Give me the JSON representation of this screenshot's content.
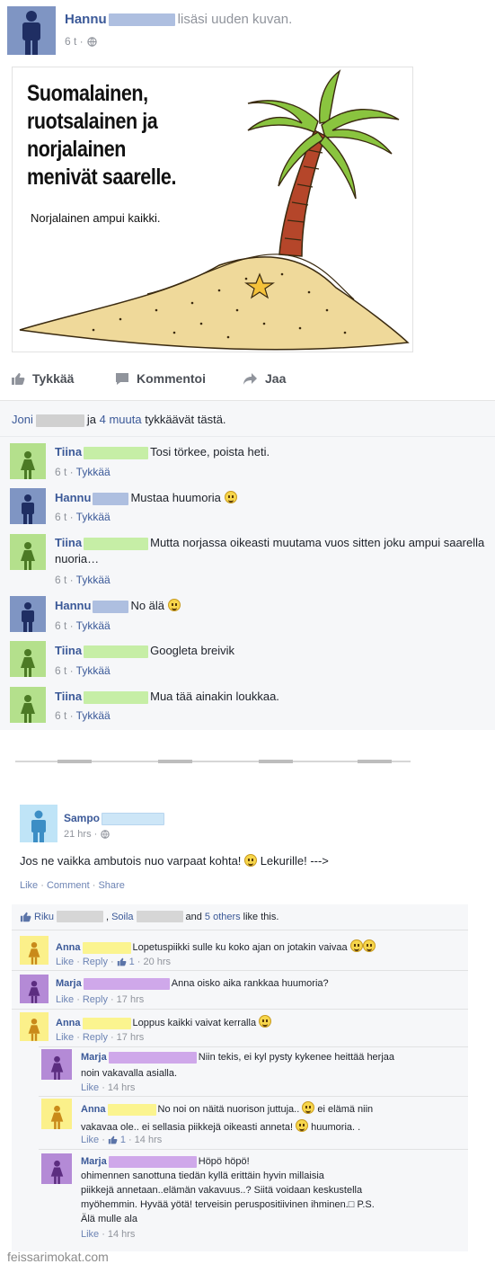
{
  "post1": {
    "author": "Hannu",
    "action": "lisäsi uuden kuvan.",
    "time": "6 t ·",
    "image": {
      "title_lines": [
        "Suomalainen,",
        "ruotsalainen ja",
        "norjalainen",
        "menivät saarelle."
      ],
      "punchline": "Norjalainen ampui kaikki."
    },
    "actions": {
      "like": "Tykkää",
      "comment": "Kommentoi",
      "share": "Jaa"
    },
    "likes": {
      "first": "Joni",
      "middle": "ja",
      "others": "4 muuta",
      "suffix": "tykkäävät tästä."
    },
    "comments": [
      {
        "author": "Tiina",
        "text": "Tosi törkee, poista heti.",
        "time": "6 t ·",
        "like": "Tykkää"
      },
      {
        "author": "Hannu",
        "text": "Mustaa huumoria",
        "time": "6 t ·",
        "like": "Tykkää"
      },
      {
        "author": "Tiina",
        "text": "Mutta norjassa oikeasti muutama vuos sitten joku ampui saarella nuoria…",
        "time": "6 t ·",
        "like": "Tykkää"
      },
      {
        "author": "Hannu",
        "text": "No älä",
        "time": "6 t ·",
        "like": "Tykkää"
      },
      {
        "author": "Tiina",
        "text": "Googleta breivik",
        "time": "6 t ·",
        "like": "Tykkää"
      },
      {
        "author": "Tiina",
        "text": "Mua tää ainakin loukkaa.",
        "time": "6 t ·",
        "like": "Tykkää"
      }
    ]
  },
  "post2": {
    "author": "Sampo",
    "time": "21 hrs ·",
    "text": "Jos ne vaikka ambutois nuo varpaat kohta!",
    "text_end": "Lekurille! --->",
    "actions": {
      "like": "Like",
      "comment": "Comment",
      "share": "Share",
      "sep": "·"
    },
    "likes": {
      "first": "Riku",
      "comma": ",",
      "second": "Soila",
      "and": "and",
      "others": "5 others",
      "suffix": "like this."
    },
    "comments": [
      {
        "author": "Anna",
        "text": "Lopetuspiikki sulle ku koko ajan on jotakin vaivaa",
        "like": "Like",
        "reply": "Reply",
        "count": "1",
        "time": "20 hrs"
      },
      {
        "author": "Marja",
        "text": "Anna oisko aika rankkaa huumoria?",
        "like": "Like",
        "reply": "Reply",
        "time": "17 hrs"
      },
      {
        "author": "Anna",
        "text": "Loppus kaikki vaivat kerralla",
        "like": "Like",
        "reply": "Reply",
        "time": "17 hrs"
      }
    ],
    "replies": [
      {
        "author": "Marja",
        "line1": "Niin tekis, ei kyl pysty kykenee heittää herjaa",
        "line2": "noin vakavalla asialla.",
        "like": "Like",
        "time": "14 hrs"
      },
      {
        "author": "Anna",
        "line1": "No noi on näitä nuorison juttuja..",
        "line1b": "ei elämä niin",
        "line2": "vakavaa ole.. ei sellasia piikkejä oikeasti anneta!",
        "line2b": "huumoria. .",
        "like": "Like",
        "count": "1",
        "time": "14 hrs"
      },
      {
        "author": "Marja",
        "line1": "Höpö höpö!",
        "line2": "ohimennen sanottuna tiedän kyllä erittäin hyvin millaisia",
        "line3": "piikkejä annetaan..elämän vakavuus..? Siitä voidaan keskustella",
        "line4": "myöhemmin. Hyvää yötä! terveisin peruspositiivinen ihminen.□ P.S.",
        "line5": "Älä mulle ala",
        "like": "Like",
        "time": "14 hrs"
      }
    ]
  },
  "watermark": "feissarimokat.com",
  "colors": {
    "link": "#3b5998",
    "male_avatar_bg": "#7f95c3",
    "male_avatar_fg": "#1f2e63",
    "female_green_bg": "#b4e08c",
    "female_green_fg": "#4c7a25",
    "light_blue_bg": "#bfe4f7",
    "light_blue_fg": "#3c8ec5",
    "yellow_bg": "#fbf08a",
    "yellow_fg": "#c98a1a",
    "purple_bg": "#b48ad6",
    "purple_fg": "#5c2d80"
  },
  "icons": [
    "like-thumb-icon",
    "comment-bubble-icon",
    "share-arrow-icon",
    "globe-icon",
    "smiley-icon"
  ]
}
